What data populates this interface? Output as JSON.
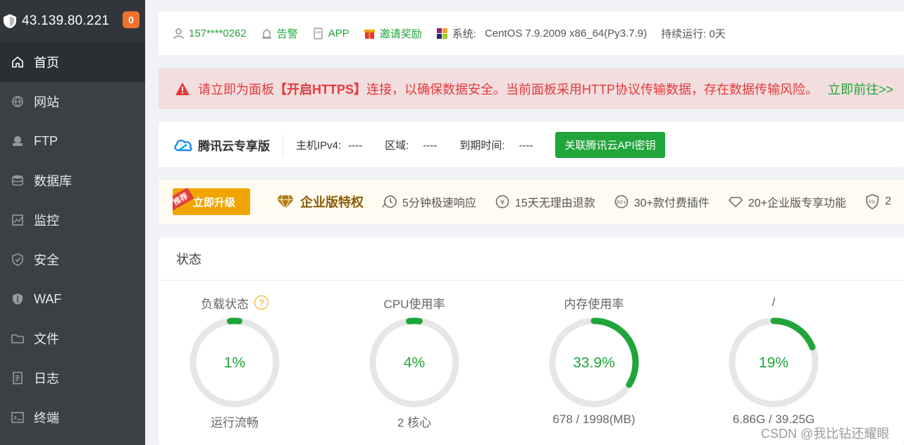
{
  "sidebar": {
    "ip": "43.139.80.221",
    "badge": "0",
    "items": [
      {
        "label": "首页",
        "icon": "home-icon"
      },
      {
        "label": "网站",
        "icon": "globe-icon"
      },
      {
        "label": "FTP",
        "icon": "ftp-icon"
      },
      {
        "label": "数据库",
        "icon": "database-icon"
      },
      {
        "label": "监控",
        "icon": "monitor-icon"
      },
      {
        "label": "安全",
        "icon": "shield-icon"
      },
      {
        "label": "WAF",
        "icon": "waf-icon"
      },
      {
        "label": "文件",
        "icon": "folder-icon"
      },
      {
        "label": "日志",
        "icon": "log-icon"
      },
      {
        "label": "终端",
        "icon": "terminal-icon"
      }
    ]
  },
  "info_bar": {
    "user": "157****0262",
    "alarm": "告警",
    "app": "APP",
    "invite": "邀请奖励",
    "system_label": "系统:",
    "system_value": "CentOS 7.9.2009 x86_64(Py3.7.9)",
    "uptime": "持续运行: 0天"
  },
  "alert": {
    "text_before": "请立即为面板",
    "highlight": "【开启HTTPS】",
    "text_after": "连接，以确保数据安全。当前面板采用HTTP协议传输数据，存在数据传输风险。",
    "link": "立即前往>>"
  },
  "tencent": {
    "logo_text": "腾讯云专享版",
    "ipv4_label": "主机IPv4:",
    "ipv4_value": "----",
    "region_label": "区域:",
    "region_value": "----",
    "expire_label": "到期时间:",
    "expire_value": "----",
    "button": "关联腾讯云API密钥"
  },
  "enterprise": {
    "tag": "推荐",
    "upgrade": "立即升级",
    "title": "企业版特权",
    "features": [
      "5分钟极速响应",
      "15天无理由退款",
      "30+款付费插件",
      "20+企业版专享功能",
      "2"
    ]
  },
  "status": {
    "title": "状态",
    "gauges": [
      {
        "label": "负载状态",
        "value": "1%",
        "percent": 1,
        "footer": "运行流畅",
        "help": "?"
      },
      {
        "label": "CPU使用率",
        "value": "4%",
        "percent": 4,
        "footer": "2 核心"
      },
      {
        "label": "内存使用率",
        "value": "33.9%",
        "percent": 33.9,
        "footer": "678 / 1998(MB)"
      },
      {
        "label": "/",
        "value": "19%",
        "percent": 19,
        "footer": "6.86G / 39.25G"
      }
    ]
  },
  "watermark": "CSDN @我比钻还耀眼",
  "colors": {
    "accent": "#20a53a",
    "sidebar": "#3b4045",
    "alert_text": "#e4393c",
    "gold": "#f0a500"
  }
}
